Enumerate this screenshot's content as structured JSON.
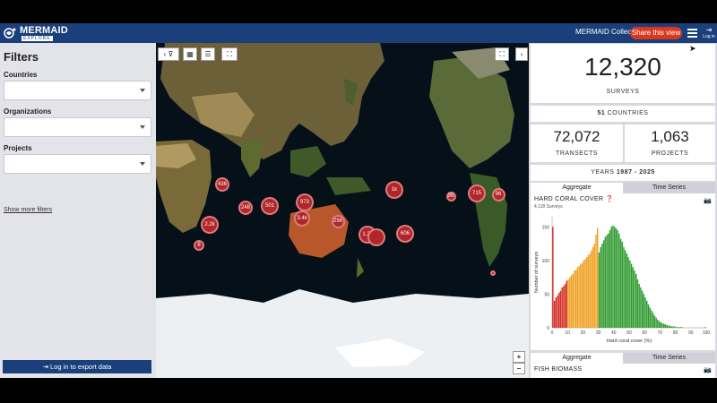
{
  "header": {
    "brand": "MERMAID",
    "brand_sub": "EXPLORE",
    "collect_link": "MERMAID Collect",
    "share_button": "Share this view",
    "login_label": "Log in",
    "login_icon": "login-icon"
  },
  "filters": {
    "title": "Filters",
    "countries_label": "Countries",
    "organizations_label": "Organizations",
    "projects_label": "Projects",
    "show_more": "Show more filters",
    "export_button": "Log in to export data"
  },
  "map": {
    "clusters": [
      {
        "label": "436"
      },
      {
        "label": "248"
      },
      {
        "label": "501"
      },
      {
        "label": "973"
      },
      {
        "label": "3.4k"
      },
      {
        "label": "2.2k"
      },
      {
        "label": "8"
      },
      {
        "label": "298"
      },
      {
        "label": "1k"
      },
      {
        "label": "1.2k"
      },
      {
        "label": ""
      },
      {
        "label": "606"
      },
      {
        "label": "36"
      },
      {
        "label": "715"
      },
      {
        "label": "96"
      },
      {
        "label": ""
      }
    ],
    "zoom_in": "+",
    "zoom_out": "−"
  },
  "summary": {
    "surveys_value": "12,320",
    "surveys_label": "SURVEYS",
    "countries_value": "51",
    "countries_label": "COUNTRIES",
    "transects_value": "72,072",
    "transects_label": "TRANSECTS",
    "projects_value": "1,063",
    "projects_label": "PROJECTS",
    "years_prefix": "YEARS",
    "years_range": "1987 - 2025"
  },
  "tabs1": {
    "aggregate": "Aggregate",
    "timeseries": "Time Series"
  },
  "tabs2": {
    "aggregate": "Aggregate",
    "timeseries": "Time Series"
  },
  "coral_chart": {
    "title": "HARD CORAL COVER",
    "subtitle": "4,118 Surveys"
  },
  "fish_chart": {
    "title": "FISH BIOMASS"
  },
  "chart_data": {
    "type": "bar",
    "title": "HARD CORAL COVER",
    "xlabel": "Hard coral cover (%)",
    "ylabel": "Number of surveys",
    "xlim": [
      0,
      100
    ],
    "ylim": [
      0,
      165
    ],
    "xticks": [
      "0",
      "10",
      "20",
      "30",
      "40",
      "50",
      "60",
      "70",
      "80",
      "90",
      "100"
    ],
    "yticks": [
      "0",
      "50",
      "100",
      "150"
    ],
    "bin_width": 1,
    "colors": {
      "low": "#d42d22",
      "mid": "#f0a020",
      "high": "#2e9a2e"
    },
    "thresholds": [
      10,
      30
    ],
    "values": [
      150,
      40,
      45,
      48,
      52,
      55,
      60,
      62,
      65,
      70,
      72,
      75,
      78,
      80,
      85,
      86,
      90,
      92,
      95,
      96,
      100,
      102,
      105,
      108,
      110,
      115,
      120,
      125,
      138,
      148,
      112,
      120,
      125,
      130,
      135,
      138,
      140,
      145,
      150,
      152,
      150,
      148,
      145,
      140,
      132,
      128,
      120,
      115,
      110,
      105,
      100,
      95,
      90,
      85,
      80,
      72,
      65,
      60,
      55,
      50,
      45,
      40,
      35,
      30,
      26,
      22,
      18,
      15,
      12,
      10,
      8,
      7,
      6,
      5,
      4,
      3,
      3,
      2,
      2,
      2,
      1,
      1,
      1,
      1,
      1,
      0,
      0,
      0,
      0,
      0,
      0,
      0,
      0,
      0,
      0,
      0,
      0,
      0,
      0,
      1
    ]
  },
  "colors": {
    "header": "#1a3f7a",
    "accent": "#d9381e",
    "cluster": "#b0262a"
  }
}
